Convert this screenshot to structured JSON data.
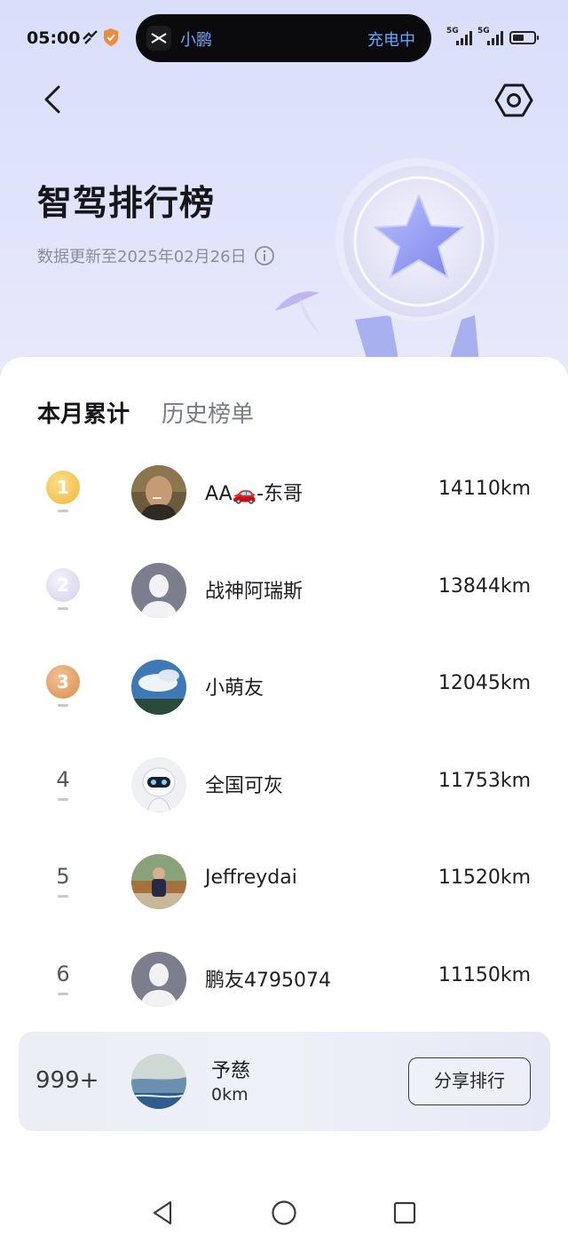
{
  "status_bar": {
    "time": "05:00",
    "island_app": "小鹏",
    "island_status": "充电中",
    "net1": "5G",
    "net2": "5G"
  },
  "header": {
    "title": "智驾排行榜",
    "update_text": "数据更新至2025年02月26日"
  },
  "tabs": [
    {
      "label": "本月累计",
      "active": true
    },
    {
      "label": "历史榜单",
      "active": false
    }
  ],
  "rankings": [
    {
      "rank": "1",
      "name": "AA🚗-东哥",
      "distance": "14110km",
      "trend": "—"
    },
    {
      "rank": "2",
      "name": "战神阿瑞斯",
      "distance": "13844km",
      "trend": "—"
    },
    {
      "rank": "3",
      "name": "小萌友",
      "distance": "12045km",
      "trend": "—"
    },
    {
      "rank": "4",
      "name": "全国可灰",
      "distance": "11753km",
      "trend": "—"
    },
    {
      "rank": "5",
      "name": "Jeffreydai",
      "distance": "11520km",
      "trend": "—"
    },
    {
      "rank": "6",
      "name": "鹏友4795074",
      "distance": "11150km",
      "trend": "—"
    }
  ],
  "my_rank": {
    "position": "999+",
    "name": "予慈",
    "distance": "0km",
    "share_label": "分享排行"
  },
  "colors": {
    "gold": "#f1c04a",
    "silver": "#d9d8ec",
    "bronze": "#e0a064",
    "accent_blue": "#6aa5ff"
  }
}
